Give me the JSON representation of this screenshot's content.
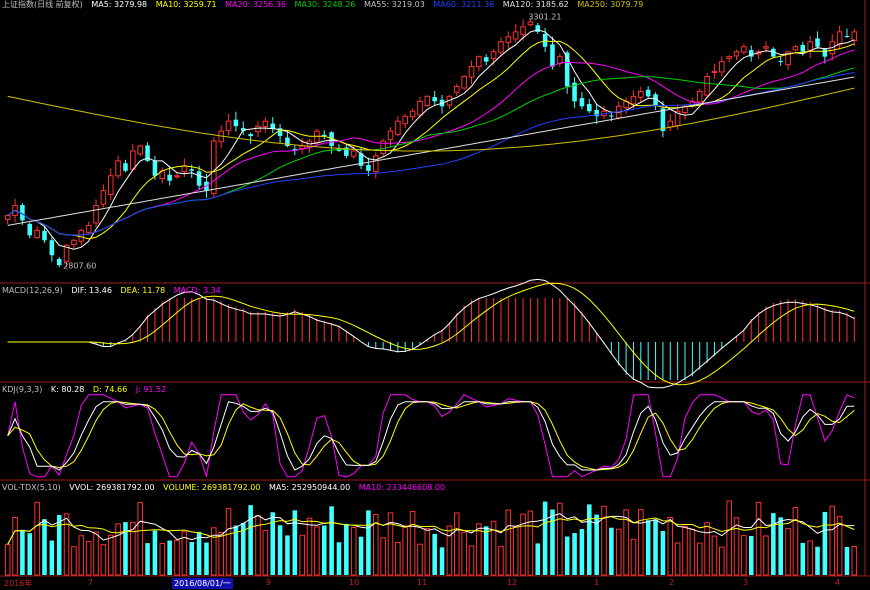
{
  "header": {
    "title": "上证指数(日线 前复权)",
    "ma5": "MA5: 3279.98",
    "ma10": "MA10: 3259.71",
    "ma20": "MA20: 3256.36",
    "ma30": "MA30: 3248.26",
    "ma55": "MA55: 3219.03",
    "ma60": "MA60: 3211.36",
    "ma120": "MA120: 3185.62",
    "ma250": "MA250: 3079.79"
  },
  "macd": {
    "title": "MACD(12,26,9)",
    "dif": "DIF: 13.46",
    "dea": "DEA: 11.78",
    "macd": "MACD: 3.34"
  },
  "kdj": {
    "title": "KDJ(9,3,3)",
    "k": "K: 80.28",
    "d": "D: 74.66",
    "j": "J: 91.52"
  },
  "vol": {
    "title": "VOL-TDX(5,10)",
    "vvol": "VVOL: 269381792.00",
    "volume": "VOLUME: 269381792.00",
    "ma5": "MA5: 252950944.00",
    "ma10": "MA10: 233446608.00"
  },
  "annotations": {
    "high": "3301.21",
    "low": "2807.60"
  },
  "xaxis": {
    "labels": [
      "2016年",
      "7",
      "9",
      "10",
      "11",
      "12",
      "1",
      "2",
      "3",
      "4"
    ],
    "selected": "2016/08/01/一"
  },
  "colors": {
    "up": "#ff3030",
    "down": "#40ffff",
    "ma5": "#ffffff",
    "ma10": "#ffff00",
    "ma20": "#ff00ff",
    "ma30": "#00d000",
    "ma55": "#8080a0",
    "ma60": "#2040ff",
    "ma120": "#e0e0e0",
    "ma250": "#d0c000",
    "grid": "#a02020"
  },
  "chart_data": {
    "type": "candlestick",
    "price_range": [
      2780,
      3320
    ],
    "period": "2016-06 to 2017-04",
    "closes": [
      2910,
      2930,
      2900,
      2870,
      2880,
      2860,
      2830,
      2810,
      2850,
      2860,
      2880,
      2890,
      2930,
      2960,
      2990,
      3020,
      3000,
      3040,
      3050,
      3020,
      2990,
      3000,
      2980,
      2990,
      3010,
      3000,
      2970,
      2960,
      3060,
      3080,
      3100,
      3090,
      3080,
      3070,
      3090,
      3100,
      3085,
      3070,
      3050,
      3040,
      3050,
      3060,
      3080,
      3070,
      3050,
      3040,
      3030,
      3040,
      3010,
      3000,
      3030,
      3060,
      3080,
      3100,
      3110,
      3120,
      3140,
      3150,
      3140,
      3130,
      3150,
      3170,
      3190,
      3210,
      3230,
      3220,
      3240,
      3260,
      3270,
      3280,
      3290,
      3300,
      3280,
      3250,
      3210,
      3230,
      3170,
      3140,
      3130,
      3120,
      3110,
      3120,
      3110,
      3130,
      3140,
      3150,
      3160,
      3150,
      3130,
      3080,
      3100,
      3120,
      3130,
      3140,
      3160,
      3190,
      3200,
      3220,
      3230,
      3240,
      3250,
      3230,
      3240,
      3250,
      3230,
      3220,
      3240,
      3250,
      3240,
      3260,
      3250,
      3230,
      3260,
      3280,
      3270,
      3280
    ],
    "high": 3301.21,
    "low": 2807.6,
    "ma_values": {
      "MA5": 3279.98,
      "MA10": 3259.71,
      "MA20": 3256.36,
      "MA30": 3248.26,
      "MA55": 3219.03,
      "MA60": 3211.36,
      "MA120": 3185.62,
      "MA250": 3079.79
    },
    "indicators": {
      "MACD": {
        "DIF": 13.46,
        "DEA": 11.78,
        "MACD": 3.34
      },
      "KDJ": {
        "K": 80.28,
        "D": 74.66,
        "J": 91.52
      },
      "VOL": {
        "VVOL": 269381792.0,
        "VOLUME": 269381792.0,
        "MA5": 252950944.0,
        "MA10": 233446608.0
      }
    }
  }
}
